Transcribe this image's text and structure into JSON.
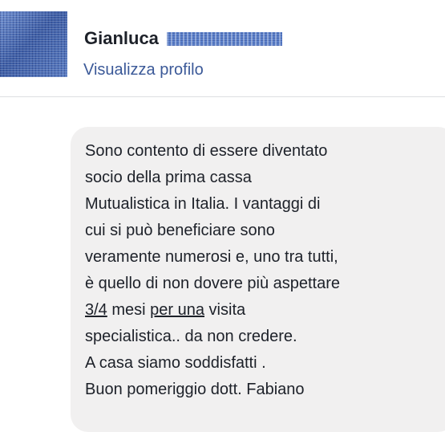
{
  "profile": {
    "name": "Gianluca",
    "view_profile_label": "Visualizza profilo"
  },
  "message": {
    "lines": [
      "Sono contento di essere diventato",
      "socio della prima cassa",
      "Mutualistica in Italia. I vantaggi di",
      "cui si può beneficiare sono",
      "veramente numerosi e, uno tra tutti,",
      "è quello di non dovere più aspettare"
    ],
    "line7": {
      "part1": "3/4",
      "part2": " mesi ",
      "part3": "per una",
      "part4": " visita"
    },
    "lines_end": [
      "specialistica.. da non credere.",
      "A casa siamo soddisfatti .",
      "Buon pomeriggio dott. Fabiano"
    ]
  },
  "colors": {
    "link": "#3b5998",
    "bubble": "#f1f0f0",
    "text": "#1d2129"
  }
}
